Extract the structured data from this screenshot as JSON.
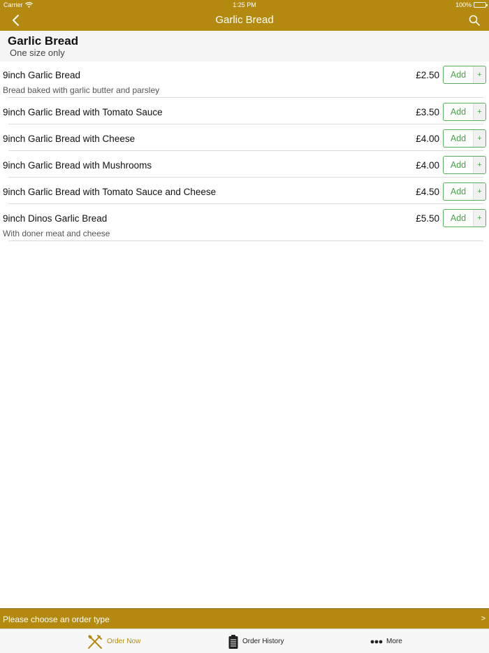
{
  "status": {
    "carrier": "Carrier",
    "time": "1:25 PM",
    "battery": "100%"
  },
  "nav": {
    "title": "Garlic Bread"
  },
  "section": {
    "name": "Garlic Bread",
    "size_note": "One size only"
  },
  "items": [
    {
      "name": "9inch Garlic Bread",
      "description": "Bread baked with garlic butter and parsley",
      "price": "£2.50",
      "add_label": "Add",
      "plus": "+"
    },
    {
      "name": "9inch Garlic Bread with Tomato Sauce",
      "description": "",
      "price": "£3.50",
      "add_label": "Add",
      "plus": "+"
    },
    {
      "name": "9inch Garlic Bread with Cheese",
      "description": "",
      "price": "£4.00",
      "add_label": "Add",
      "plus": "+"
    },
    {
      "name": "9inch Garlic Bread with Mushrooms",
      "description": "",
      "price": "£4.00",
      "add_label": "Add",
      "plus": "+"
    },
    {
      "name": "9inch Garlic Bread with Tomato Sauce and Cheese",
      "description": "",
      "price": "£4.50",
      "add_label": "Add",
      "plus": "+"
    },
    {
      "name": "9inch Dinos Garlic Bread",
      "description": "With doner meat and cheese",
      "price": "£5.50",
      "add_label": "Add",
      "plus": "+"
    }
  ],
  "order_type": {
    "label": "Please choose an order type",
    "arrow": ">"
  },
  "tabs": {
    "order_now": "Order Now",
    "order_history": "Order History",
    "more": "More"
  },
  "colors": {
    "brand": "#b38a0f",
    "add_green": "#4aa04a",
    "header_bg": "#f5f5f5"
  },
  "icons": {
    "back": "chevron-left-icon",
    "search": "search-icon",
    "order_now": "fork-knife-icon",
    "order_history": "clipboard-icon",
    "more": "ellipsis-icon",
    "wifi": "wifi-icon",
    "battery": "battery-icon"
  }
}
